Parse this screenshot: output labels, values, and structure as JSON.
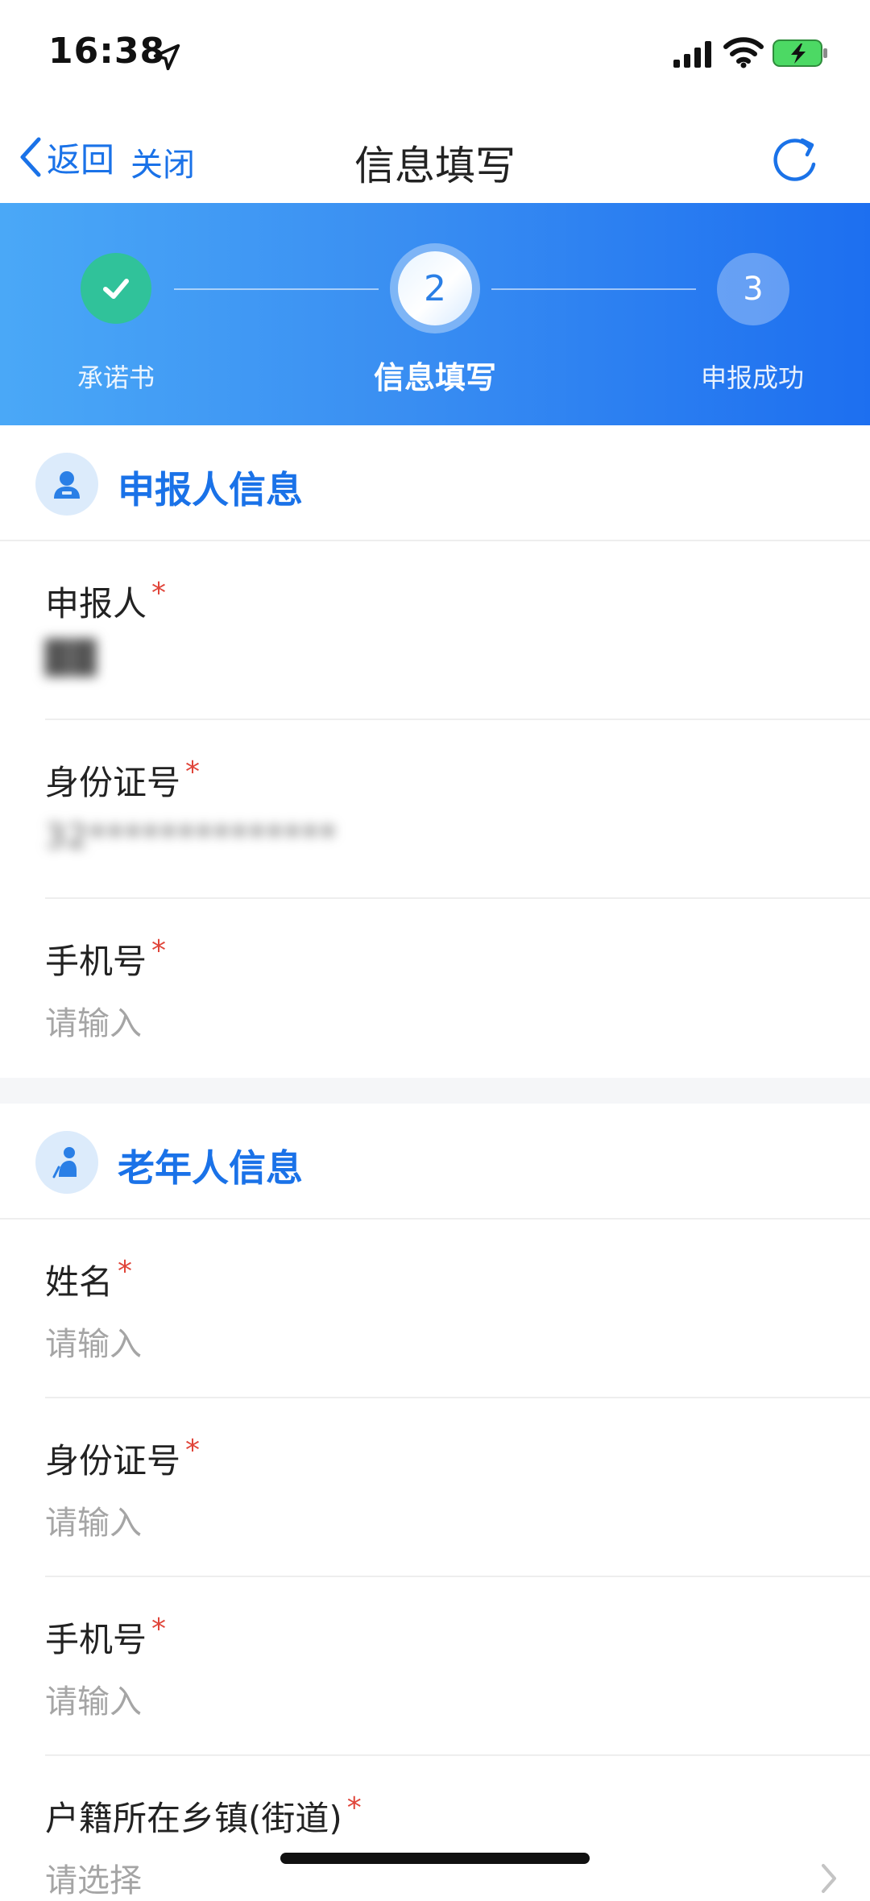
{
  "status_bar": {
    "time": "16:38"
  },
  "nav": {
    "back_label": "返回",
    "close_label": "关闭",
    "title": "信息填写"
  },
  "steps": [
    {
      "label": "承诺书",
      "state": "done"
    },
    {
      "label": "信息填写",
      "number": "2",
      "state": "current"
    },
    {
      "label": "申报成功",
      "number": "3",
      "state": "pending"
    }
  ],
  "applicant_section": {
    "title": "申报人信息",
    "fields": [
      {
        "label": "申报人",
        "value": "██",
        "required": "*"
      },
      {
        "label": "身份证号",
        "value": "32**************",
        "required": "*"
      },
      {
        "label": "手机号",
        "placeholder": "请输入",
        "required": "*"
      }
    ]
  },
  "elder_section": {
    "title": "老年人信息",
    "fields": [
      {
        "label": "姓名",
        "placeholder": "请输入",
        "required": "*"
      },
      {
        "label": "身份证号",
        "placeholder": "请输入",
        "required": "*"
      },
      {
        "label": "手机号",
        "placeholder": "请输入",
        "required": "*"
      },
      {
        "label": "户籍所在乡镇(街道)",
        "placeholder": "请选择",
        "required": "*"
      }
    ]
  },
  "colors": {
    "accent": "#1a72e8",
    "step_done": "#30c29a",
    "required": "#e0453a",
    "placeholder": "#a5a5a5"
  }
}
